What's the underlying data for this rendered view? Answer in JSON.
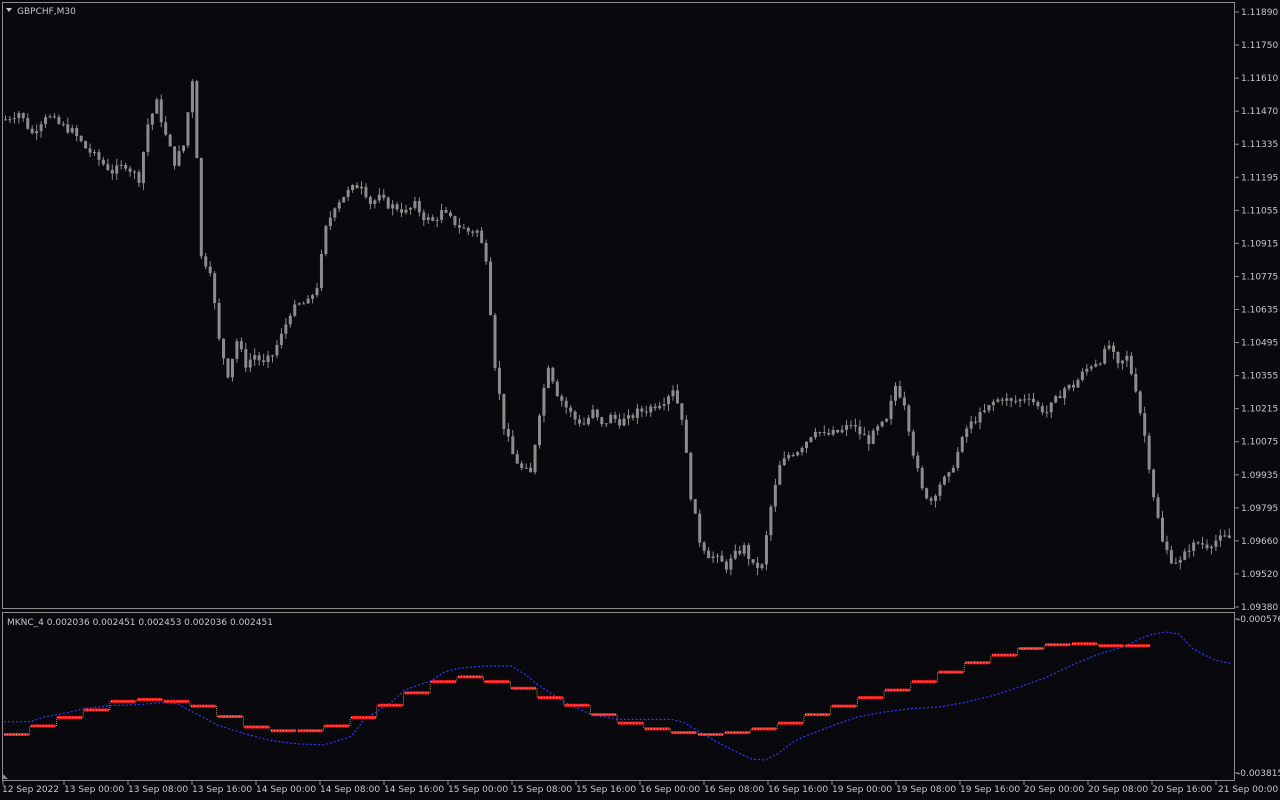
{
  "window": {
    "symbol_label": "GBPCHF,M30",
    "indicator_label": "MKNC_4 0.002036 0.002451 0.002453 0.002036 0.002451"
  },
  "colors": {
    "background": "#09090d",
    "candles": "#8c8c8c",
    "frame": "#8c8c8c",
    "blue_line": "#2a3cff",
    "red_steps": "#ff1a1a",
    "text": "#c8c8c8"
  },
  "price_axis": {
    "labels": [
      "1.11890",
      "1.11750",
      "1.11610",
      "1.11470",
      "1.11335",
      "1.11195",
      "1.11055",
      "1.10915",
      "1.10775",
      "1.10635",
      "1.10495",
      "1.10355",
      "1.10215",
      "1.10075",
      "1.09935",
      "1.09795",
      "1.09660",
      "1.09520",
      "1.09380"
    ],
    "ylim": [
      1.0938,
      1.1189
    ]
  },
  "indicator_axis": {
    "labels": [
      "-0.000576",
      "-0.003815"
    ],
    "ylim": [
      -0.003815,
      -0.000576
    ]
  },
  "time_axis": {
    "labels": [
      "12 Sep 2022",
      "13 Sep 00:00",
      "13 Sep 08:00",
      "13 Sep 16:00",
      "14 Sep 00:00",
      "14 Sep 08:00",
      "14 Sep 16:00",
      "15 Sep 00:00",
      "15 Sep 08:00",
      "15 Sep 16:00",
      "16 Sep 00:00",
      "16 Sep 08:00",
      "16 Sep 16:00",
      "19 Sep 00:00",
      "19 Sep 08:00",
      "19 Sep 16:00",
      "20 Sep 00:00",
      "20 Sep 08:00",
      "20 Sep 16:00",
      "21 Sep 00:00"
    ]
  },
  "chart_data": [
    {
      "type": "candlestick",
      "title": "GBPCHF,M30",
      "ylim": [
        1.0938,
        1.1189
      ],
      "close_path": [
        [
          0,
          1.1143
        ],
        [
          3,
          1.1146
        ],
        [
          6,
          1.1137
        ],
        [
          9,
          1.1145
        ],
        [
          12,
          1.1141
        ],
        [
          15,
          1.1138
        ],
        [
          18,
          1.1131
        ],
        [
          21,
          1.1126
        ],
        [
          24,
          1.1121
        ],
        [
          27,
          1.1124
        ],
        [
          30,
          1.1118
        ],
        [
          32,
          1.1141
        ],
        [
          34,
          1.115
        ],
        [
          36,
          1.1136
        ],
        [
          38,
          1.1125
        ],
        [
          40,
          1.1132
        ],
        [
          42,
          1.116
        ],
        [
          43,
          1.1128
        ],
        [
          44,
          1.1085
        ],
        [
          46,
          1.108
        ],
        [
          48,
          1.105
        ],
        [
          50,
          1.1036
        ],
        [
          52,
          1.105
        ],
        [
          54,
          1.104
        ],
        [
          56,
          1.1044
        ],
        [
          58,
          1.104
        ],
        [
          60,
          1.1044
        ],
        [
          62,
          1.1052
        ],
        [
          64,
          1.1062
        ],
        [
          66,
          1.1065
        ],
        [
          68,
          1.1066
        ],
        [
          70,
          1.1073
        ],
        [
          72,
          1.1097
        ],
        [
          74,
          1.1107
        ],
        [
          76,
          1.1111
        ],
        [
          78,
          1.1114
        ],
        [
          80,
          1.1116
        ],
        [
          82,
          1.1108
        ],
        [
          84,
          1.111
        ],
        [
          86,
          1.1107
        ],
        [
          88,
          1.1106
        ],
        [
          90,
          1.1104
        ],
        [
          92,
          1.1107
        ],
        [
          94,
          1.1102
        ],
        [
          96,
          1.11
        ],
        [
          98,
          1.1104
        ],
        [
          100,
          1.1101
        ],
        [
          102,
          1.1098
        ],
        [
          104,
          1.1096
        ],
        [
          106,
          1.1096
        ],
        [
          108,
          1.1085
        ],
        [
          110,
          1.104
        ],
        [
          112,
          1.1014
        ],
        [
          114,
          1.1002
        ],
        [
          116,
          1.0996
        ],
        [
          118,
          1.0994
        ],
        [
          120,
          1.102
        ],
        [
          122,
          1.104
        ],
        [
          124,
          1.1028
        ],
        [
          126,
          1.1022
        ],
        [
          128,
          1.1017
        ],
        [
          130,
          1.1015
        ],
        [
          132,
          1.102
        ],
        [
          134,
          1.1014
        ],
        [
          136,
          1.1018
        ],
        [
          138,
          1.1016
        ],
        [
          140,
          1.1017
        ],
        [
          142,
          1.102
        ],
        [
          144,
          1.1021
        ],
        [
          146,
          1.1023
        ],
        [
          148,
          1.1025
        ],
        [
          150,
          1.103
        ],
        [
          152,
          1.1018
        ],
        [
          154,
          1.0985
        ],
        [
          156,
          1.0966
        ],
        [
          158,
          1.096
        ],
        [
          160,
          1.0958
        ],
        [
          162,
          1.0955
        ],
        [
          164,
          1.096
        ],
        [
          166,
          1.0963
        ],
        [
          168,
          1.0955
        ],
        [
          170,
          1.0955
        ],
        [
          172,
          1.098
        ],
        [
          174,
          1.0997
        ],
        [
          176,
          1.1002
        ],
        [
          178,
          1.1004
        ],
        [
          180,
          1.1008
        ],
        [
          182,
          1.1013
        ],
        [
          184,
          1.101
        ],
        [
          186,
          1.1011
        ],
        [
          188,
          1.1012
        ],
        [
          190,
          1.1015
        ],
        [
          192,
          1.1011
        ],
        [
          194,
          1.1008
        ],
        [
          196,
          1.1013
        ],
        [
          198,
          1.1016
        ],
        [
          200,
          1.1031
        ],
        [
          202,
          1.1024
        ],
        [
          204,
          1.1003
        ],
        [
          206,
          1.0987
        ],
        [
          208,
          1.0983
        ],
        [
          210,
          1.099
        ],
        [
          212,
          1.0993
        ],
        [
          214,
          1.1003
        ],
        [
          216,
          1.1013
        ],
        [
          218,
          1.1017
        ],
        [
          220,
          1.102
        ],
        [
          222,
          1.1024
        ],
        [
          224,
          1.1026
        ],
        [
          226,
          1.1024
        ],
        [
          228,
          1.1025
        ],
        [
          230,
          1.1027
        ],
        [
          232,
          1.1022
        ],
        [
          234,
          1.102
        ],
        [
          236,
          1.1025
        ],
        [
          238,
          1.103
        ],
        [
          240,
          1.1031
        ],
        [
          242,
          1.1036
        ],
        [
          244,
          1.104
        ],
        [
          246,
          1.1042
        ],
        [
          248,
          1.1048
        ],
        [
          250,
          1.1039
        ],
        [
          252,
          1.1043
        ],
        [
          254,
          1.103
        ],
        [
          256,
          1.101
        ],
        [
          258,
          1.0985
        ],
        [
          260,
          1.0965
        ],
        [
          262,
          1.0958
        ],
        [
          264,
          1.0957
        ],
        [
          266,
          1.0963
        ],
        [
          268,
          1.0965
        ],
        [
          270,
          1.0964
        ],
        [
          272,
          1.0966
        ],
        [
          274,
          1.0967
        ]
      ]
    },
    {
      "type": "line",
      "title": "MKNC_4 0.002036 0.002451 0.002453 0.002036 0.002451",
      "ylim": [
        -0.003815,
        -0.000576
      ],
      "series": [
        {
          "color": "#2a3cff",
          "style": "dotted",
          "points": [
            [
              0,
              -0.00273
            ],
            [
              6,
              -0.00273
            ],
            [
              9,
              -0.00263
            ],
            [
              12,
              -0.00258
            ],
            [
              15,
              -0.00252
            ],
            [
              18,
              -0.00245
            ],
            [
              24,
              -0.00239
            ],
            [
              30,
              -0.00237
            ],
            [
              36,
              -0.00232
            ],
            [
              39,
              -0.00235
            ],
            [
              42,
              -0.0025
            ],
            [
              48,
              -0.0028
            ],
            [
              54,
              -0.00298
            ],
            [
              60,
              -0.00313
            ],
            [
              66,
              -0.0032
            ],
            [
              72,
              -0.00322
            ],
            [
              78,
              -0.00304
            ],
            [
              81,
              -0.00268
            ],
            [
              84,
              -0.0025
            ],
            [
              87,
              -0.00232
            ],
            [
              90,
              -0.00206
            ],
            [
              96,
              -0.00186
            ],
            [
              99,
              -0.00168
            ],
            [
              102,
              -0.0016
            ],
            [
              108,
              -0.00155
            ],
            [
              114,
              -0.00155
            ],
            [
              117,
              -0.00172
            ],
            [
              120,
              -0.00195
            ],
            [
              126,
              -0.00232
            ],
            [
              132,
              -0.00258
            ],
            [
              138,
              -0.00268
            ],
            [
              144,
              -0.00268
            ],
            [
              150,
              -0.00268
            ],
            [
              153,
              -0.00275
            ],
            [
              156,
              -0.00293
            ],
            [
              162,
              -0.00325
            ],
            [
              168,
              -0.00352
            ],
            [
              171,
              -0.00354
            ],
            [
              174,
              -0.0034
            ],
            [
              177,
              -0.00318
            ],
            [
              180,
              -0.00304
            ],
            [
              186,
              -0.00282
            ],
            [
              192,
              -0.00262
            ],
            [
              198,
              -0.00252
            ],
            [
              204,
              -0.00245
            ],
            [
              210,
              -0.00242
            ],
            [
              216,
              -0.00232
            ],
            [
              222,
              -0.00218
            ],
            [
              228,
              -0.002
            ],
            [
              234,
              -0.0018
            ],
            [
              240,
              -0.00153
            ],
            [
              246,
              -0.0013
            ],
            [
              252,
              -0.00113
            ],
            [
              255,
              -0.00098
            ],
            [
              258,
              -0.00088
            ],
            [
              261,
              -0.00083
            ],
            [
              264,
              -0.00087
            ],
            [
              267,
              -0.00117
            ],
            [
              270,
              -0.00133
            ],
            [
              273,
              -0.00145
            ],
            [
              276,
              -0.0015
            ]
          ]
        },
        {
          "color": "#ff1a1a",
          "style": "steps",
          "points": [
            [
              0,
              -0.003
            ],
            [
              6,
              -0.00282
            ],
            [
              12,
              -0.00264
            ],
            [
              18,
              -0.00248
            ],
            [
              24,
              -0.0023
            ],
            [
              30,
              -0.00226
            ],
            [
              36,
              -0.0023
            ],
            [
              42,
              -0.0024
            ],
            [
              48,
              -0.00262
            ],
            [
              54,
              -0.00284
            ],
            [
              60,
              -0.00292
            ],
            [
              66,
              -0.00292
            ],
            [
              72,
              -0.00282
            ],
            [
              78,
              -0.00264
            ],
            [
              84,
              -0.00238
            ],
            [
              90,
              -0.00212
            ],
            [
              96,
              -0.00188
            ],
            [
              102,
              -0.00178
            ],
            [
              108,
              -0.00188
            ],
            [
              114,
              -0.00202
            ],
            [
              120,
              -0.00222
            ],
            [
              126,
              -0.00238
            ],
            [
              132,
              -0.00258
            ],
            [
              138,
              -0.00276
            ],
            [
              144,
              -0.00288
            ],
            [
              150,
              -0.00296
            ],
            [
              156,
              -0.003
            ],
            [
              162,
              -0.00296
            ],
            [
              168,
              -0.00288
            ],
            [
              174,
              -0.00276
            ],
            [
              180,
              -0.00258
            ],
            [
              186,
              -0.0024
            ],
            [
              192,
              -0.00222
            ],
            [
              198,
              -0.00206
            ],
            [
              204,
              -0.00188
            ],
            [
              210,
              -0.00168
            ],
            [
              216,
              -0.00148
            ],
            [
              222,
              -0.00132
            ],
            [
              228,
              -0.00118
            ],
            [
              234,
              -0.0011
            ],
            [
              240,
              -0.00108
            ],
            [
              246,
              -0.00112
            ],
            [
              252,
              -0.00112
            ]
          ]
        }
      ]
    }
  ]
}
